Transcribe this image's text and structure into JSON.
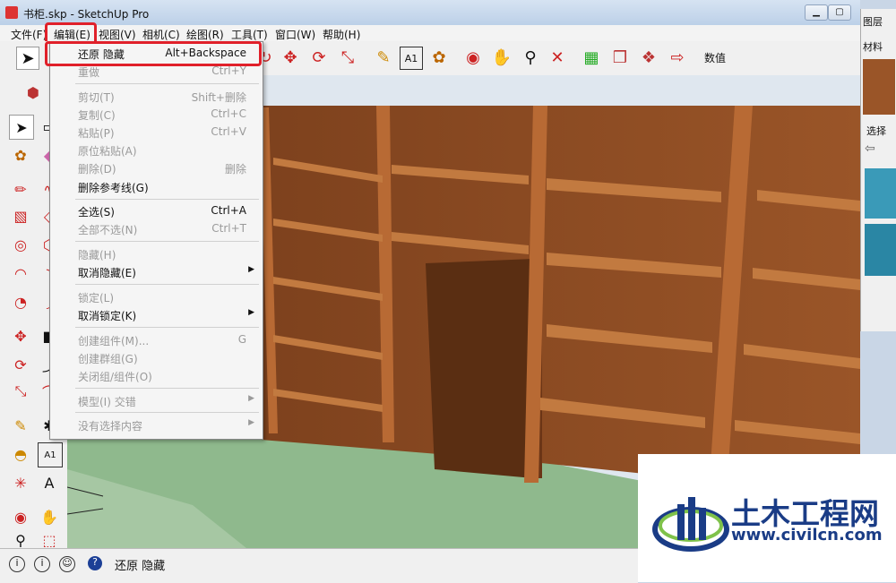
{
  "window": {
    "title": "书柜.skp - SketchUp Pro"
  },
  "menubar": [
    "文件(F)",
    "编辑(E)",
    "视图(V)",
    "相机(C)",
    "绘图(R)",
    "工具(T)",
    "窗口(W)",
    "帮助(H)"
  ],
  "toolbar": {
    "value_label": "数值"
  },
  "right_panel": {
    "layers": "图层",
    "materials": "材料",
    "select": "选择"
  },
  "edit_menu": {
    "items": [
      {
        "label": "还原 隐藏",
        "shortcut": "Alt+Backspace"
      },
      {
        "label": "重做",
        "shortcut": "Ctrl+Y"
      },
      {
        "label": "剪切(T)",
        "shortcut": "Shift+删除"
      },
      {
        "label": "复制(C)",
        "shortcut": "Ctrl+C"
      },
      {
        "label": "粘贴(P)",
        "shortcut": "Ctrl+V"
      },
      {
        "label": "原位粘贴(A)",
        "shortcut": ""
      },
      {
        "label": "删除(D)",
        "shortcut": "删除"
      },
      {
        "label": "删除参考线(G)",
        "shortcut": ""
      },
      {
        "label": "全选(S)",
        "shortcut": "Ctrl+A"
      },
      {
        "label": "全部不选(N)",
        "shortcut": "Ctrl+T"
      },
      {
        "label": "隐藏(H)",
        "shortcut": ""
      },
      {
        "label": "取消隐藏(E)",
        "shortcut": ""
      },
      {
        "label": "锁定(L)",
        "shortcut": ""
      },
      {
        "label": "取消锁定(K)",
        "shortcut": ""
      },
      {
        "label": "创建组件(M)...",
        "shortcut": "G"
      },
      {
        "label": "创建群组(G)",
        "shortcut": ""
      },
      {
        "label": "关闭组/组件(O)",
        "shortcut": ""
      },
      {
        "label": "模型(I) 交错",
        "shortcut": ""
      },
      {
        "label": "没有选择内容",
        "shortcut": ""
      }
    ]
  },
  "status": {
    "text": "还原 隐藏"
  },
  "watermark": {
    "name": "土木工程网",
    "url": "www.civilcn.com"
  },
  "colors": {
    "highlight": "#e0202a",
    "floor": "#8fb98d",
    "wood": "#8a4a22",
    "brand": "#1a3c86"
  }
}
